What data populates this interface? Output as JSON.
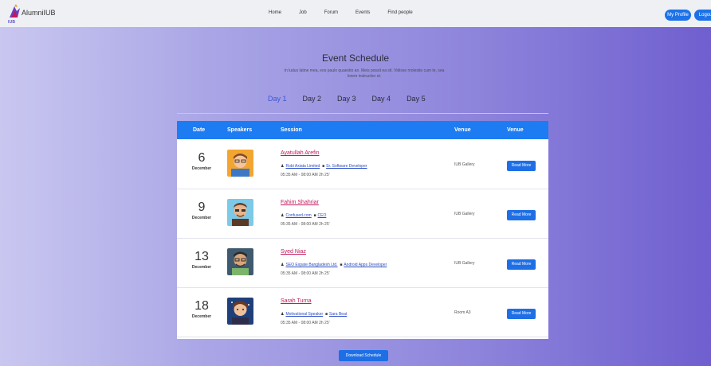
{
  "header": {
    "logo_text": "AlumniIUB",
    "logo_sub": "IUB",
    "nav": [
      "Home",
      "Job",
      "Forum",
      "Events",
      "Find people"
    ],
    "profile_label": "My Profile",
    "logout_label": "Logout"
  },
  "hero": {
    "title": "Event Schedule",
    "subtitle": "In ludus latine mea, eos paulo quaestio an. Meis possit ea sit. Vidisse molestie cum te, sea lorem instructior et."
  },
  "days": [
    "Day 1",
    "Day 2",
    "Day 3",
    "Day 4",
    "Day 5"
  ],
  "active_day": "Day 1",
  "table": {
    "headers": [
      "Date",
      "Speakers",
      "Session",
      "Venue",
      "Venue"
    ],
    "rows": [
      {
        "day": "6",
        "month": "December",
        "name": "Ayatullah Arefin",
        "org": "Robi Axiata Limited",
        "role": "Sr. Software Developer",
        "time": "05:35 AM - 08:00 AM 2h 25'",
        "venue": "IUB Gallery",
        "button": "Read More",
        "avatar": "avatar-1"
      },
      {
        "day": "9",
        "month": "December",
        "name": "Fahim Shahriar",
        "org": "Confused.com",
        "role": "CEO",
        "time": "05:35 AM - 08:00 AM 2h 25'",
        "venue": "IUB Gallery",
        "button": "Read More",
        "avatar": "avatar-2"
      },
      {
        "day": "13",
        "month": "December",
        "name": "Syed Niaz",
        "org": "SEO Expate Bangladesh Ltd.",
        "role": "Android Apps Developer",
        "time": "05:35 AM - 08:00 AM 2h 25'",
        "venue": "IUB Gallery",
        "button": "Read More",
        "avatar": "avatar-3"
      },
      {
        "day": "18",
        "month": "December",
        "name": "Sarah Turna",
        "org": "Motivational Speaker",
        "role": "Sara Beat",
        "time": "05:35 AM - 08:00 AM 2h 25'",
        "venue": "Room A3",
        "button": "Read More",
        "avatar": "avatar-4"
      }
    ]
  },
  "download_label": "Download Schedule",
  "colors": {
    "accent": "#1e6fe6",
    "header_bar": "#1e7cf2",
    "name_link": "#c2185b",
    "active_day": "#3a56d8"
  }
}
